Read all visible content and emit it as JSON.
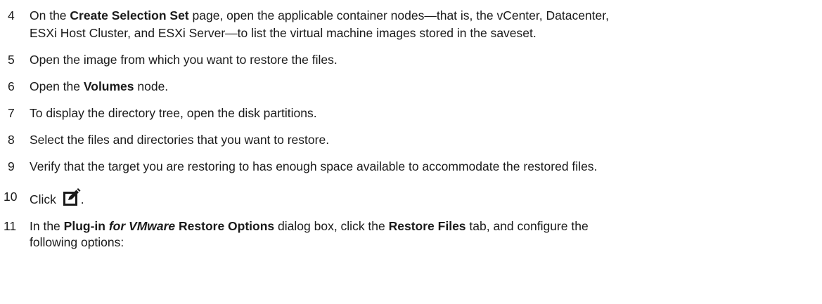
{
  "steps": [
    {
      "num": "4",
      "line1": {
        "pre": "On the ",
        "bold": "Create Selection Set",
        "post": " page, open the applicable container nodes—that is, the vCenter, Datacenter,"
      },
      "line2": "ESXi Host Cluster, and ESXi Server—to list the virtual machine images stored in the saveset."
    },
    {
      "num": "5",
      "text": "Open the image from which you want to restore the files."
    },
    {
      "num": "6",
      "pre": "Open the ",
      "bold": "Volumes",
      "post": " node."
    },
    {
      "num": "7",
      "text": "To display the directory tree, open the disk partitions."
    },
    {
      "num": "8",
      "text": "Select the files and directories that you want to restore."
    },
    {
      "num": "9",
      "text": "Verify that the target you are restoring to has enough space available to accommodate the restored files."
    },
    {
      "num": "10",
      "pre": "Click",
      "icon": "edit-icon",
      "post": "."
    },
    {
      "num": "11",
      "line1": {
        "pre": "In the ",
        "bold1": "Plug-in",
        "bolditalic": "for VMware",
        "bold2": "Restore Options",
        "mid": " dialog box, click the ",
        "bold3": "Restore Files",
        "post": " tab, and configure the"
      },
      "line2": "following options:"
    }
  ]
}
